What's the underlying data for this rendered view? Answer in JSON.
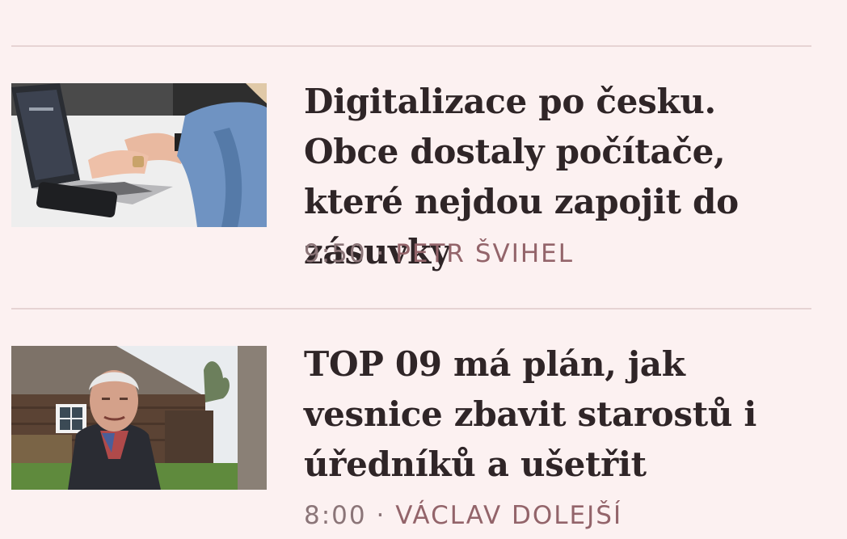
{
  "articles": [
    {
      "headline": "Digitalizace po česku. Obce dostaly počítače, které nejdou zapojit do zásuvky",
      "time": "9:50",
      "separator": "·",
      "author": "PETR ŠVIHEL",
      "image_icon": "laptop-typing-photo"
    },
    {
      "headline": "TOP 09 má plán, jak vesnice zbavit starostů i úředníků a ušetřit",
      "time": "8:00",
      "separator": "·",
      "author": "VÁCLAV DOLEJŠÍ",
      "image_icon": "elderly-man-village-photo"
    }
  ],
  "colors": {
    "background": "#fcf1f1",
    "divider": "#e6d3d3",
    "headline": "#2f2527",
    "time": "#8b7578",
    "author": "#93646a"
  }
}
